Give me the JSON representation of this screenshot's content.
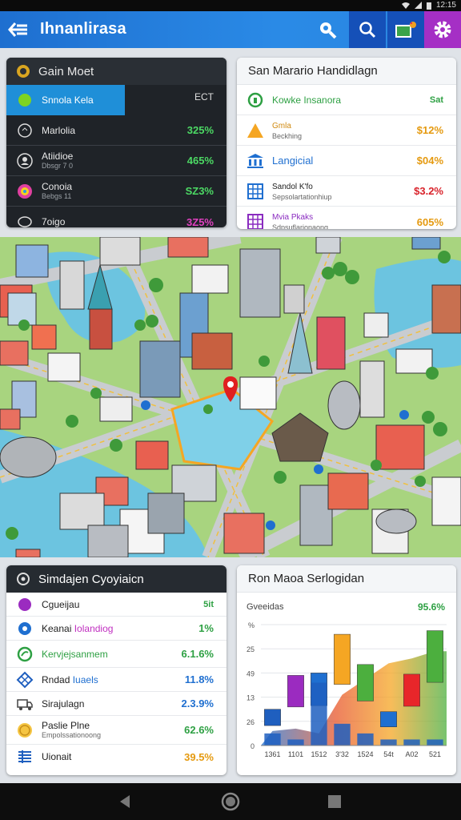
{
  "status": {
    "time": "12:15"
  },
  "appbar": {
    "title": "Ihnanlirasa",
    "icons": [
      "back-arrow-icon",
      "search-icon",
      "search-icon",
      "photo-icon",
      "settings-icon"
    ]
  },
  "card_tl": {
    "title": "Gain Moet",
    "rows": [
      {
        "label": "Snnola Kela",
        "value": "ECT",
        "icon": "circle-icon"
      },
      {
        "label": "Marlolia",
        "value": "325%",
        "icon": "target-icon"
      },
      {
        "label": "Atiidioe",
        "sub": "Dbsgr 7 0",
        "value": "465%",
        "icon": "people-icon"
      },
      {
        "label": "Conoia",
        "sub": "Bebgs 11",
        "value": "SZ3%",
        "icon": "palette-icon"
      },
      {
        "label": "7oigo",
        "value": "3Z5%",
        "icon": "loop-icon"
      }
    ]
  },
  "card_tr": {
    "title": "San Marario Handidlagn",
    "rows": [
      {
        "label": "Kowke Insanora",
        "value": "Sat",
        "icon": "circle-icon"
      },
      {
        "label": "Gmla",
        "sub": "Beckhing",
        "value": "$12%",
        "icon": "warning-icon"
      },
      {
        "label": "Langicial",
        "value": "$04%",
        "icon": "bank-icon"
      },
      {
        "label": "Sandol K'fo",
        "sub": "Sepsolartationhiup",
        "value": "$3.2%",
        "icon": "grid-icon"
      },
      {
        "label": "Mvia Pkaks",
        "sub": "Sdpsuflarionaong",
        "value": "605%",
        "icon": "grid-icon"
      }
    ]
  },
  "map": {
    "pin": "location-pin-icon"
  },
  "card_bl": {
    "title": "Simdajen Cyoyiaicn",
    "rows": [
      {
        "label": "Cgueijau",
        "value": "5it",
        "icon": "dot-icon"
      },
      {
        "label": "Keanai",
        "label2": "Iolandiog",
        "value": "1%",
        "icon": "drop-icon"
      },
      {
        "label": "Kervjejsanmem",
        "value": "6.1.6%",
        "icon": "leaf-icon"
      },
      {
        "label": "Rndad",
        "label2": "Iuaels",
        "value": "11.8%",
        "icon": "network-icon"
      },
      {
        "label": "Sirajulagn",
        "value": "2.3.9%",
        "icon": "truck-icon"
      },
      {
        "label": "Paslie Plne",
        "sub": "Empolssationoong",
        "value": "62.6%",
        "icon": "coin-icon"
      },
      {
        "label": "Uionait",
        "value": "39.5%",
        "icon": "bars-icon"
      }
    ]
  },
  "card_br": {
    "title": "Ron Maoa Serlogidan",
    "legend_label": "Gveeidas",
    "legend_value": "95.6%",
    "y_ticks": [
      "%",
      "25",
      "49",
      "13",
      "26",
      "0"
    ],
    "x_ticks": [
      "1361",
      "1101",
      "1512",
      "3'32",
      "1524",
      "54t",
      "A02",
      "521"
    ]
  },
  "chart_data": {
    "type": "bar",
    "title": "Ron Maoa Serlogidan",
    "categories": [
      "1361",
      "1101",
      "1512",
      "3'32",
      "1524",
      "54t",
      "A02",
      "521"
    ],
    "series": [
      {
        "name": "Gveeidas",
        "values": [
          30,
          58,
          60,
          92,
          67,
          28,
          59,
          95
        ],
        "colors": [
          "#1f5fbf",
          "#9b2bc0",
          "#1f6fd0",
          "#f5a623",
          "#4caf3e",
          "#1f6fd0",
          "#e8262a",
          "#4caf3e"
        ]
      }
    ],
    "lower_bars": [
      10,
      5,
      52,
      18,
      10,
      5,
      5,
      5
    ],
    "area": [
      12,
      14,
      10,
      42,
      55,
      68,
      72,
      78
    ],
    "ylim": [
      0,
      100
    ]
  },
  "navbar": {
    "icons": [
      "back-icon",
      "home-icon",
      "recents-icon"
    ]
  }
}
